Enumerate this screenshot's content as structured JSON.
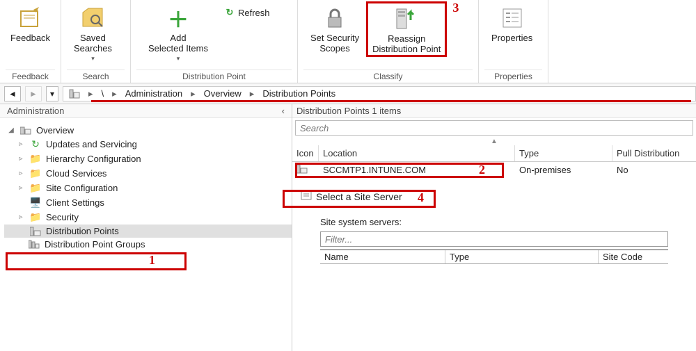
{
  "ribbon": {
    "feedback": {
      "label": "Feedback",
      "group": "Feedback"
    },
    "search": {
      "saved": "Saved\nSearches",
      "group": "Search"
    },
    "dist_point": {
      "add": "Add\nSelected Items",
      "refresh": "Refresh",
      "group": "Distribution Point"
    },
    "classify": {
      "scopes": "Set Security\nScopes",
      "reassign": "Reassign\nDistribution Point",
      "group": "Classify"
    },
    "properties": {
      "label": "Properties",
      "group": "Properties"
    }
  },
  "badges": {
    "n1": "1",
    "n2": "2",
    "n3": "3",
    "n4": "4"
  },
  "breadcrumb": {
    "root": "\\",
    "items": [
      "Administration",
      "Overview",
      "Distribution Points"
    ]
  },
  "tree": {
    "title": "Administration",
    "root": "Overview",
    "nodes": [
      "Updates and Servicing",
      "Hierarchy Configuration",
      "Cloud Services",
      "Site Configuration",
      "Client Settings",
      "Security",
      "Distribution Points",
      "Distribution Point Groups"
    ]
  },
  "list": {
    "title": "Distribution Points 1 items",
    "search_placeholder": "Search",
    "columns": {
      "icon": "Icon",
      "loc": "Location",
      "type": "Type",
      "pull": "Pull Distribution"
    },
    "row": {
      "location": "SCCMTP1.INTUNE.COM",
      "type": "On-premises",
      "pull": "No"
    }
  },
  "detail": {
    "title": "Select a Site Server",
    "servers_label": "Site system servers:",
    "filter_placeholder": "Filter...",
    "columns": {
      "name": "Name",
      "type": "Type",
      "code": "Site Code"
    }
  }
}
